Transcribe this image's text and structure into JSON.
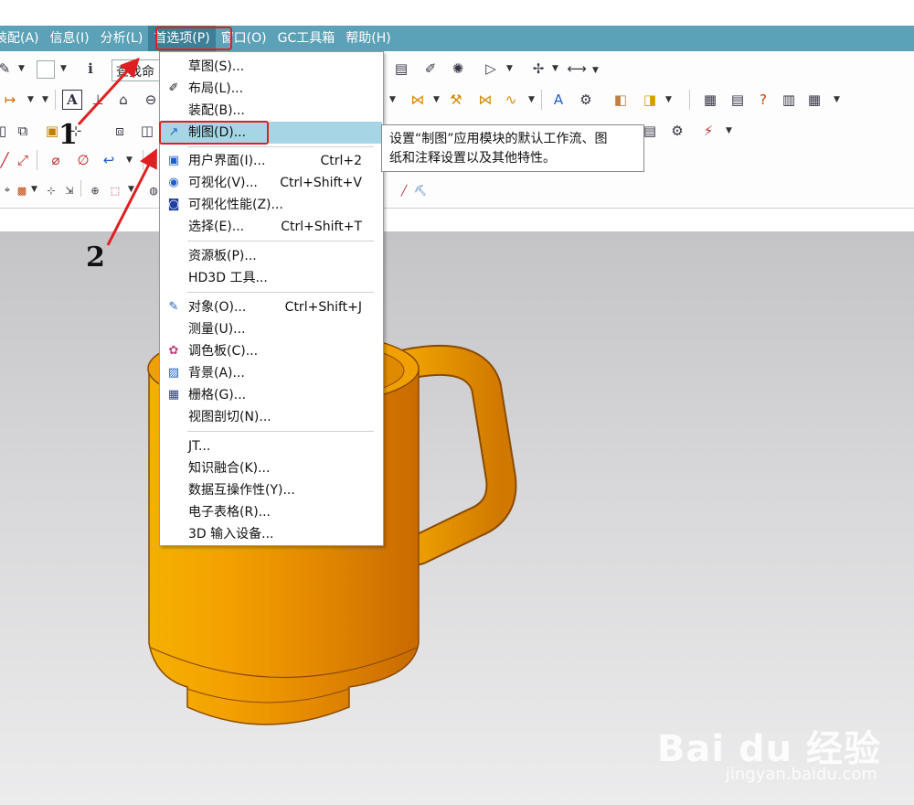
{
  "menubar": {
    "items": [
      "装配(A)",
      "信息(I)",
      "分析(L)",
      "首选项(P)",
      "窗口(O)",
      "GC工具箱",
      "帮助(H)"
    ],
    "active_index": 3
  },
  "toolbar": {
    "search_text": "查找命"
  },
  "dropdown": {
    "items": [
      {
        "label": "草图(S)...",
        "shortcut": "",
        "icon": ""
      },
      {
        "label": "布局(L)...",
        "shortcut": "",
        "icon": "layout-icon"
      },
      {
        "label": "装配(B)...",
        "shortcut": "",
        "icon": ""
      },
      {
        "label": "制图(D)...",
        "shortcut": "",
        "icon": "drafting-icon"
      },
      {
        "label": "用户界面(I)...",
        "shortcut": "Ctrl+2",
        "icon": "user-interface-icon"
      },
      {
        "label": "可视化(V)...",
        "shortcut": "Ctrl+Shift+V",
        "icon": "visualization-icon"
      },
      {
        "label": "可视化性能(Z)...",
        "shortcut": "",
        "icon": "visual-performance-icon"
      },
      {
        "label": "选择(E)...",
        "shortcut": "Ctrl+Shift+T",
        "icon": ""
      },
      {
        "label": "资源板(P)...",
        "shortcut": "",
        "icon": ""
      },
      {
        "label": "HD3D 工具...",
        "shortcut": "",
        "icon": ""
      },
      {
        "label": "对象(O)...",
        "shortcut": "Ctrl+Shift+J",
        "icon": "object-icon"
      },
      {
        "label": "测量(U)...",
        "shortcut": "",
        "icon": ""
      },
      {
        "label": "调色板(C)...",
        "shortcut": "",
        "icon": "palette-icon"
      },
      {
        "label": "背景(A)...",
        "shortcut": "",
        "icon": "background-icon"
      },
      {
        "label": "栅格(G)...",
        "shortcut": "",
        "icon": "grid-icon"
      },
      {
        "label": "视图剖切(N)...",
        "shortcut": "",
        "icon": ""
      },
      {
        "label": "JT...",
        "shortcut": "",
        "icon": ""
      },
      {
        "label": "知识融合(K)...",
        "shortcut": "",
        "icon": ""
      },
      {
        "label": "数据互操作性(Y)...",
        "shortcut": "",
        "icon": ""
      },
      {
        "label": "电子表格(R)...",
        "shortcut": "",
        "icon": ""
      },
      {
        "label": "3D 输入设备...",
        "shortcut": "",
        "icon": ""
      }
    ],
    "highlighted_index": 3
  },
  "tooltip": {
    "line1": "设置“制图”应用模块的默认工作流、图",
    "line2": "纸和注释设置以及其他特性。"
  },
  "annotations": {
    "step1": "1",
    "step2": "2"
  },
  "watermark": {
    "brand": "Bai du 经验",
    "url": "jingyan.baidu.com"
  },
  "colors": {
    "menubar": "#5ba2b8",
    "highlight": "#a6d6e6",
    "annotation_red": "#e02020",
    "mug": "#f5a000"
  }
}
